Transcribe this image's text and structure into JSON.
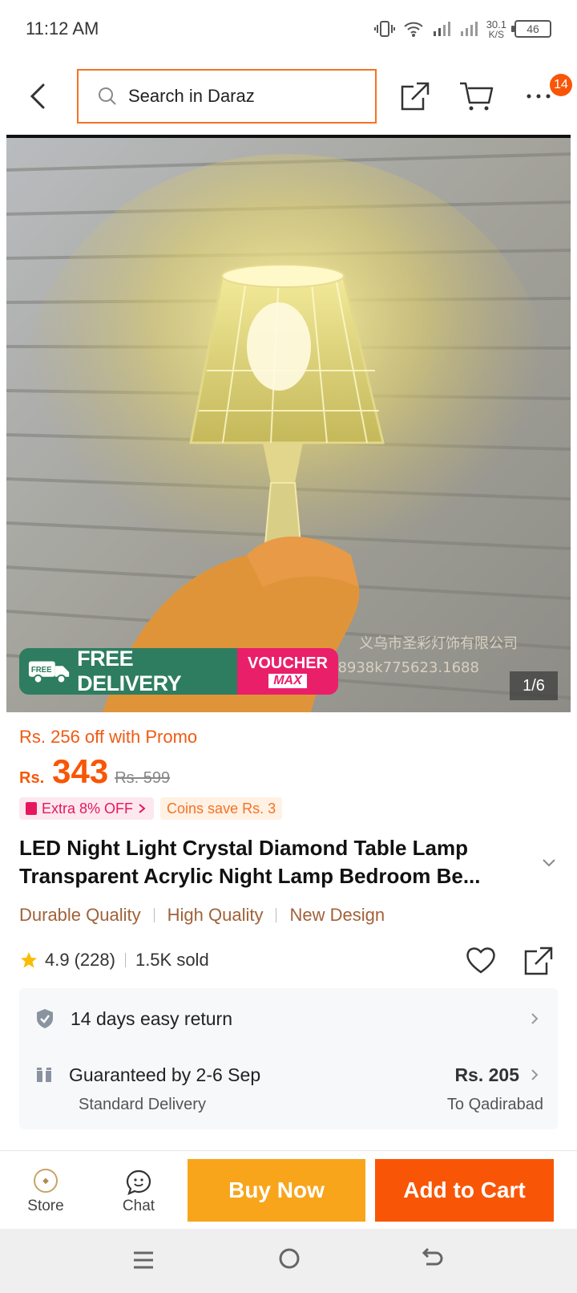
{
  "status_bar": {
    "time": "11:12 AM",
    "net_speed_value": "30.1",
    "net_speed_unit": "K/S",
    "battery": "46"
  },
  "header": {
    "search_placeholder": "Search in Daraz",
    "cart_badge": "14"
  },
  "product": {
    "image_counter": "1/6",
    "free_delivery_small": "FREE",
    "free_delivery_text": "FREE DELIVERY",
    "voucher_top": "VOUCHER",
    "voucher_bottom": "MAX",
    "watermark_line1": "义乌市圣彩灯饰有限公司",
    "watermark_line2": "58938k775623.1688",
    "promo_text": "Rs. 256 off with Promo",
    "price_prefix": "Rs.",
    "price": "343",
    "original_price": "Rs. 599",
    "tag_extra": "Extra 8% OFF",
    "tag_coins": "Coins save Rs. 3",
    "title": "LED Night Light Crystal Diamond Table Lamp Transparent Acrylic Night Lamp Bedroom Be...",
    "features": [
      "Durable Quality",
      "High Quality",
      "New Design"
    ],
    "rating": "4.9",
    "review_count": "(228)",
    "sold": "1.5K sold"
  },
  "delivery": {
    "return_text": "14 days easy return",
    "guarantee_text": "Guaranteed by 2-6 Sep",
    "delivery_type": "Standard Delivery",
    "delivery_price": "Rs. 205",
    "destination": "To Qadirabad"
  },
  "bottom_bar": {
    "store_label": "Store",
    "chat_label": "Chat",
    "buy_now_label": "Buy Now",
    "add_to_cart_label": "Add to Cart"
  },
  "colors": {
    "accent": "#f85606",
    "buy_now": "#f8a51b",
    "free_delivery": "#2e7d60",
    "voucher": "#ea1f6a"
  }
}
